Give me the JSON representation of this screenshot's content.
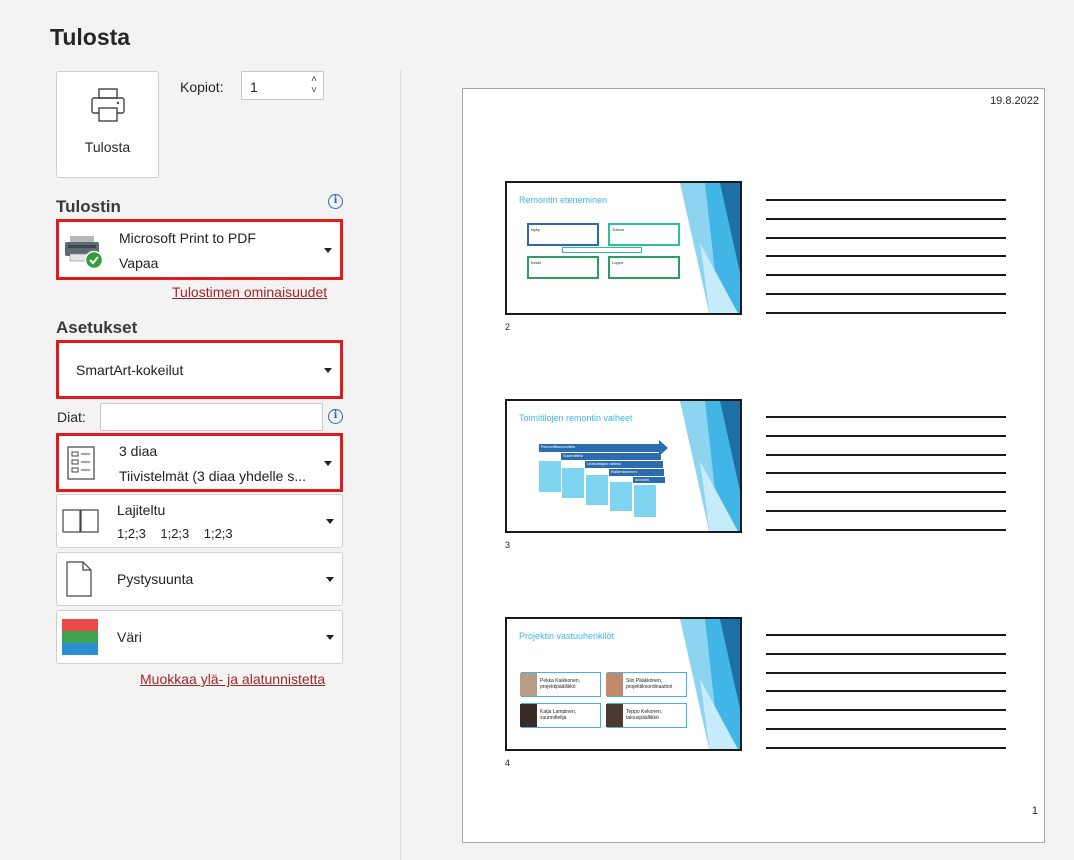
{
  "title": "Tulosta",
  "print_button": {
    "label": "Tulosta",
    "icon": "printer-icon"
  },
  "copies": {
    "label": "Kopiot:",
    "value": "1"
  },
  "printer": {
    "heading": "Tulostin",
    "name": "Microsoft Print to PDF",
    "status": "Vapaa",
    "properties_link": "Tulostimen ominaisuudet"
  },
  "settings": {
    "heading": "Asetukset",
    "slide_range": "SmartArt-kokeilut",
    "slides_label": "Diat:",
    "slides_value": "",
    "layout": {
      "line1": "3 diaa",
      "line2": "Tiivistelmät (3 diaa yhdelle s..."
    },
    "collation": {
      "line1": "Lajiteltu",
      "line2": "1;2;3    1;2;3    1;2;3"
    },
    "orientation": "Pystysuunta",
    "color": "Väri",
    "header_footer_link": "Muokkaa ylä- ja alatunnistetta"
  },
  "preview": {
    "date": "19.8.2022",
    "page_number": "1",
    "slides": [
      {
        "number": "2",
        "title": "Remontin eteneminen",
        "boxes": [
          "Nyky",
          "Tuleva",
          "Keski",
          "Loppu"
        ]
      },
      {
        "number": "3",
        "title": "Toimitilojen remontin vaiheet",
        "steps": [
          "Remonttisuunnitelu",
          "Suunnittelu",
          "Urakoitsijan valinta",
          "Rakentaminen",
          "Arviointi"
        ]
      },
      {
        "number": "4",
        "title": "Projektin vastuuhenkilöt",
        "people": [
          {
            "name": "Pekka Kaikkonen,",
            "role": "projektipäällikkö"
          },
          {
            "name": "Siiri Pääkkönen,",
            "role": "projektikoordinaattori"
          },
          {
            "name": "Katja Lampinen,",
            "role": "suunnittelija"
          },
          {
            "name": "Teppo Kekonen,",
            "role": "talouspäällikkö"
          }
        ]
      }
    ]
  },
  "colors": {
    "accent_red": "#e11b1b",
    "link": "#a4262c",
    "slide_title": "#41b6e6"
  }
}
